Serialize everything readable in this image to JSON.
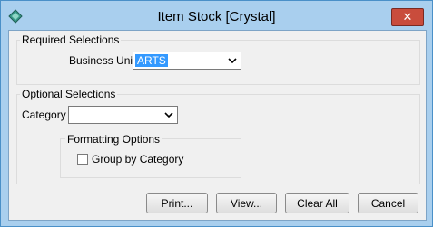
{
  "window": {
    "title": "Item Stock  [Crystal]"
  },
  "required": {
    "group_label": "Required Selections",
    "business_unit_label": "Business Unit",
    "business_unit_value": "ARTS"
  },
  "optional": {
    "group_label": "Optional Selections",
    "category_label": "Category",
    "category_value": "",
    "formatting": {
      "group_label": "Formatting Options",
      "group_by_label": "Group by Category",
      "group_by_checked": false
    }
  },
  "buttons": {
    "print": "Print...",
    "view": "View...",
    "clear_all": "Clear All",
    "cancel": "Cancel"
  }
}
